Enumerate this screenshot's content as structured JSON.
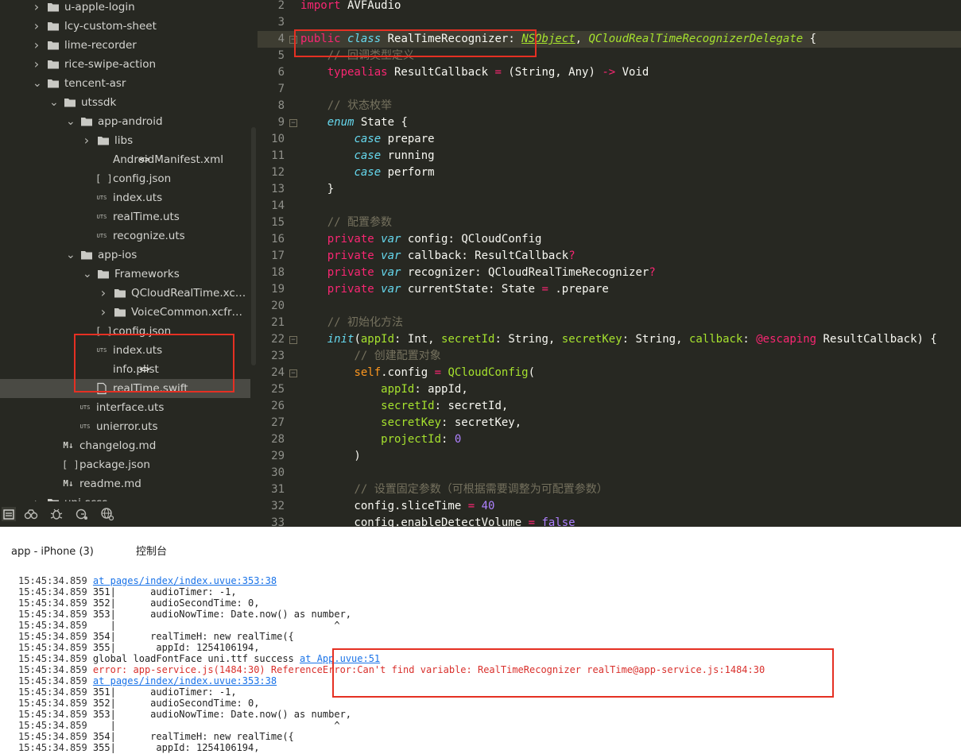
{
  "sidebar": {
    "items": [
      {
        "label": "u-apple-login",
        "depth": 2,
        "icon": "folder",
        "chevron": "right",
        "selected": false
      },
      {
        "label": "lcy-custom-sheet",
        "depth": 2,
        "icon": "folder",
        "chevron": "right",
        "selected": false
      },
      {
        "label": "lime-recorder",
        "depth": 2,
        "icon": "folder",
        "chevron": "right",
        "selected": false
      },
      {
        "label": "rice-swipe-action",
        "depth": 2,
        "icon": "folder",
        "chevron": "right",
        "selected": false
      },
      {
        "label": "tencent-asr",
        "depth": 2,
        "icon": "folder",
        "chevron": "down",
        "selected": false
      },
      {
        "label": "utssdk",
        "depth": 3,
        "icon": "folder",
        "chevron": "down",
        "selected": false
      },
      {
        "label": "app-android",
        "depth": 4,
        "icon": "folder",
        "chevron": "down",
        "selected": false
      },
      {
        "label": "libs",
        "depth": 5,
        "icon": "folder",
        "chevron": "right",
        "selected": false
      },
      {
        "label": "AndroidManifest.xml",
        "depth": 5,
        "icon": "code",
        "chevron": "",
        "selected": false
      },
      {
        "label": "config.json",
        "depth": 5,
        "icon": "brackets",
        "chevron": "",
        "selected": false
      },
      {
        "label": "index.uts",
        "depth": 5,
        "icon": "uts",
        "chevron": "",
        "selected": false
      },
      {
        "label": "realTime.uts",
        "depth": 5,
        "icon": "uts",
        "chevron": "",
        "selected": false
      },
      {
        "label": "recognize.uts",
        "depth": 5,
        "icon": "uts",
        "chevron": "",
        "selected": false
      },
      {
        "label": "app-ios",
        "depth": 4,
        "icon": "folder",
        "chevron": "down",
        "selected": false
      },
      {
        "label": "Frameworks",
        "depth": 5,
        "icon": "folder",
        "chevron": "down",
        "selected": false
      },
      {
        "label": "QCloudRealTime.xcf...",
        "depth": 6,
        "icon": "folder",
        "chevron": "right",
        "selected": false
      },
      {
        "label": "VoiceCommon.xcfra...",
        "depth": 6,
        "icon": "folder",
        "chevron": "right",
        "selected": false
      },
      {
        "label": "config.json",
        "depth": 5,
        "icon": "brackets",
        "chevron": "",
        "selected": false
      },
      {
        "label": "index.uts",
        "depth": 5,
        "icon": "uts",
        "chevron": "",
        "selected": false
      },
      {
        "label": "info.plist",
        "depth": 5,
        "icon": "code",
        "chevron": "",
        "selected": false
      },
      {
        "label": "realTime.swift",
        "depth": 5,
        "icon": "file",
        "chevron": "",
        "selected": true
      },
      {
        "label": "interface.uts",
        "depth": 4,
        "icon": "uts",
        "chevron": "",
        "selected": false
      },
      {
        "label": "unierror.uts",
        "depth": 4,
        "icon": "uts",
        "chevron": "",
        "selected": false
      },
      {
        "label": "changelog.md",
        "depth": 3,
        "icon": "markdown",
        "chevron": "",
        "selected": false
      },
      {
        "label": "package.json",
        "depth": 3,
        "icon": "brackets",
        "chevron": "",
        "selected": false
      },
      {
        "label": "readme.md",
        "depth": 3,
        "icon": "markdown",
        "chevron": "",
        "selected": false
      },
      {
        "label": "uni-scss",
        "depth": 2,
        "icon": "folder",
        "chevron": "right",
        "selected": false
      }
    ],
    "toolbar_icons": [
      "explorer-icon",
      "binoculars-icon",
      "debug-bug-icon",
      "git-icon",
      "globe-icon"
    ]
  },
  "editor": {
    "current_line": 4,
    "lines": [
      {
        "n": "2",
        "fold": false,
        "tokens": [
          [
            "kw",
            "import"
          ],
          [
            "pl",
            " AVFAudio"
          ]
        ]
      },
      {
        "n": "3",
        "fold": false,
        "tokens": []
      },
      {
        "n": "4",
        "fold": true,
        "tokens": [
          [
            "kw",
            "public"
          ],
          [
            "pl",
            " "
          ],
          [
            "kwi",
            "class"
          ],
          [
            "pl",
            " RealTimeRecognizer: "
          ],
          [
            "typeu",
            "NSObject"
          ],
          [
            "pl",
            ", "
          ],
          [
            "type",
            "QCloudRealTimeRecognizerDelegate"
          ],
          [
            "pl",
            " {"
          ]
        ]
      },
      {
        "n": "5",
        "fold": false,
        "tokens": [
          [
            "pl",
            "    "
          ],
          [
            "cm",
            "// 回调类型定义"
          ]
        ]
      },
      {
        "n": "6",
        "fold": false,
        "tokens": [
          [
            "pl",
            "    "
          ],
          [
            "kw",
            "typealias"
          ],
          [
            "pl",
            " ResultCallback "
          ],
          [
            "kw",
            "="
          ],
          [
            "pl",
            " (String, Any) "
          ],
          [
            "kw",
            "->"
          ],
          [
            "pl",
            " Void"
          ]
        ]
      },
      {
        "n": "7",
        "fold": false,
        "tokens": []
      },
      {
        "n": "8",
        "fold": false,
        "tokens": [
          [
            "pl",
            "    "
          ],
          [
            "cm",
            "// 状态枚举"
          ]
        ]
      },
      {
        "n": "9",
        "fold": true,
        "tokens": [
          [
            "pl",
            "    "
          ],
          [
            "kwi",
            "enum"
          ],
          [
            "pl",
            " State {"
          ]
        ]
      },
      {
        "n": "10",
        "fold": false,
        "tokens": [
          [
            "pl",
            "        "
          ],
          [
            "kwi",
            "case"
          ],
          [
            "pl",
            " prepare"
          ]
        ]
      },
      {
        "n": "11",
        "fold": false,
        "tokens": [
          [
            "pl",
            "        "
          ],
          [
            "kwi",
            "case"
          ],
          [
            "pl",
            " running"
          ]
        ]
      },
      {
        "n": "12",
        "fold": false,
        "tokens": [
          [
            "pl",
            "        "
          ],
          [
            "kwi",
            "case"
          ],
          [
            "pl",
            " perform"
          ]
        ]
      },
      {
        "n": "13",
        "fold": false,
        "tokens": [
          [
            "pl",
            "    }"
          ]
        ]
      },
      {
        "n": "14",
        "fold": false,
        "tokens": []
      },
      {
        "n": "15",
        "fold": false,
        "tokens": [
          [
            "pl",
            "    "
          ],
          [
            "cm",
            "// 配置参数"
          ]
        ]
      },
      {
        "n": "16",
        "fold": false,
        "tokens": [
          [
            "pl",
            "    "
          ],
          [
            "kw",
            "private"
          ],
          [
            "pl",
            " "
          ],
          [
            "kwi",
            "var"
          ],
          [
            "pl",
            " config: QCloudConfig"
          ]
        ]
      },
      {
        "n": "17",
        "fold": false,
        "tokens": [
          [
            "pl",
            "    "
          ],
          [
            "kw",
            "private"
          ],
          [
            "pl",
            " "
          ],
          [
            "kwi",
            "var"
          ],
          [
            "pl",
            " callback: ResultCallback"
          ],
          [
            "kw",
            "?"
          ]
        ]
      },
      {
        "n": "18",
        "fold": false,
        "tokens": [
          [
            "pl",
            "    "
          ],
          [
            "kw",
            "private"
          ],
          [
            "pl",
            " "
          ],
          [
            "kwi",
            "var"
          ],
          [
            "pl",
            " recognizer: QCloudRealTimeRecognizer"
          ],
          [
            "kw",
            "?"
          ]
        ]
      },
      {
        "n": "19",
        "fold": false,
        "tokens": [
          [
            "pl",
            "    "
          ],
          [
            "kw",
            "private"
          ],
          [
            "pl",
            " "
          ],
          [
            "kwi",
            "var"
          ],
          [
            "pl",
            " currentState: State "
          ],
          [
            "kw",
            "="
          ],
          [
            "pl",
            " .prepare"
          ]
        ]
      },
      {
        "n": "20",
        "fold": false,
        "tokens": []
      },
      {
        "n": "21",
        "fold": false,
        "tokens": [
          [
            "pl",
            "    "
          ],
          [
            "cm",
            "// 初始化方法"
          ]
        ]
      },
      {
        "n": "22",
        "fold": true,
        "tokens": [
          [
            "pl",
            "    "
          ],
          [
            "kwi",
            "init"
          ],
          [
            "pl",
            "("
          ],
          [
            "param",
            "appId"
          ],
          [
            "pl",
            ": Int, "
          ],
          [
            "param",
            "secretId"
          ],
          [
            "pl",
            ": String, "
          ],
          [
            "param",
            "secretKey"
          ],
          [
            "pl",
            ": String, "
          ],
          [
            "param",
            "callback"
          ],
          [
            "pl",
            ": "
          ],
          [
            "kw",
            "@escaping"
          ],
          [
            "pl",
            " ResultCallback) {"
          ]
        ]
      },
      {
        "n": "23",
        "fold": false,
        "tokens": [
          [
            "pl",
            "        "
          ],
          [
            "cm",
            "// 创建配置对象"
          ]
        ]
      },
      {
        "n": "24",
        "fold": true,
        "tokens": [
          [
            "pl",
            "        "
          ],
          [
            "self",
            "self"
          ],
          [
            "pl",
            ".config "
          ],
          [
            "kw",
            "="
          ],
          [
            "pl",
            " "
          ],
          [
            "fn",
            "QCloudConfig"
          ],
          [
            "pl",
            "("
          ]
        ]
      },
      {
        "n": "25",
        "fold": false,
        "tokens": [
          [
            "pl",
            "            "
          ],
          [
            "param",
            "appId"
          ],
          [
            "pl",
            ": appId,"
          ]
        ]
      },
      {
        "n": "26",
        "fold": false,
        "tokens": [
          [
            "pl",
            "            "
          ],
          [
            "param",
            "secretId"
          ],
          [
            "pl",
            ": secretId,"
          ]
        ]
      },
      {
        "n": "27",
        "fold": false,
        "tokens": [
          [
            "pl",
            "            "
          ],
          [
            "param",
            "secretKey"
          ],
          [
            "pl",
            ": secretKey,"
          ]
        ]
      },
      {
        "n": "28",
        "fold": false,
        "tokens": [
          [
            "pl",
            "            "
          ],
          [
            "param",
            "projectId"
          ],
          [
            "pl",
            ": "
          ],
          [
            "num",
            "0"
          ]
        ]
      },
      {
        "n": "29",
        "fold": false,
        "tokens": [
          [
            "pl",
            "        )"
          ]
        ]
      },
      {
        "n": "30",
        "fold": false,
        "tokens": []
      },
      {
        "n": "31",
        "fold": false,
        "tokens": [
          [
            "pl",
            "        "
          ],
          [
            "cm",
            "// 设置固定参数（可根据需要调整为可配置参数）"
          ]
        ]
      },
      {
        "n": "32",
        "fold": false,
        "tokens": [
          [
            "pl",
            "        config.sliceTime "
          ],
          [
            "kw",
            "="
          ],
          [
            "pl",
            " "
          ],
          [
            "num",
            "40"
          ]
        ]
      },
      {
        "n": "33",
        "fold": false,
        "tokens": [
          [
            "pl",
            "        config.enableDetectVolume "
          ],
          [
            "kw",
            "="
          ],
          [
            "pl",
            " "
          ],
          [
            "num",
            "false"
          ]
        ]
      }
    ]
  },
  "panel": {
    "tabs": [
      "app - iPhone (3)",
      "控制台"
    ]
  },
  "console": {
    "lines": [
      {
        "parts": [
          [
            "ts",
            "15:45:34.859 "
          ],
          [
            "lk",
            "at pages/index/index.uvue:353:38"
          ]
        ]
      },
      {
        "parts": [
          [
            "ts",
            "15:45:34.859 "
          ],
          [
            "tx",
            "351|      audioTimer: -1,"
          ]
        ]
      },
      {
        "parts": [
          [
            "ts",
            "15:45:34.859 "
          ],
          [
            "tx",
            "352|      audioSecondTime: 0,"
          ]
        ]
      },
      {
        "parts": [
          [
            "ts",
            "15:45:34.859 "
          ],
          [
            "tx",
            "353|      audioNowTime: Date.now() as number,"
          ]
        ]
      },
      {
        "parts": [
          [
            "ts",
            "15:45:34.859 "
          ],
          [
            "tx",
            "   |                                      ^"
          ]
        ]
      },
      {
        "parts": [
          [
            "ts",
            "15:45:34.859 "
          ],
          [
            "tx",
            "354|      realTimeH: new realTime({"
          ]
        ]
      },
      {
        "parts": [
          [
            "ts",
            "15:45:34.859 "
          ],
          [
            "tx",
            "355|       appId: 1254106194,"
          ]
        ]
      },
      {
        "parts": [
          [
            "ts",
            "15:45:34.859 "
          ],
          [
            "tx",
            "global loadFontFace uni.ttf success "
          ],
          [
            "lk",
            "at App.uvue:51"
          ]
        ]
      },
      {
        "parts": [
          [
            "ts",
            "15:45:34.859 "
          ],
          [
            "er",
            "error: app-service.js(1484:30) ReferenceError:Can't find variable: RealTimeRecognizer realTime@app-service.js:1484:30"
          ]
        ]
      },
      {
        "parts": [
          [
            "ts",
            "15:45:34.859 "
          ],
          [
            "lk",
            "at pages/index/index.uvue:353:38"
          ]
        ]
      },
      {
        "parts": [
          [
            "ts",
            "15:45:34.859 "
          ],
          [
            "tx",
            "351|      audioTimer: -1,"
          ]
        ]
      },
      {
        "parts": [
          [
            "ts",
            "15:45:34.859 "
          ],
          [
            "tx",
            "352|      audioSecondTime: 0,"
          ]
        ]
      },
      {
        "parts": [
          [
            "ts",
            "15:45:34.859 "
          ],
          [
            "tx",
            "353|      audioNowTime: Date.now() as number,"
          ]
        ]
      },
      {
        "parts": [
          [
            "ts",
            "15:45:34.859 "
          ],
          [
            "tx",
            "   |                                      ^"
          ]
        ]
      },
      {
        "parts": [
          [
            "ts",
            "15:45:34.859 "
          ],
          [
            "tx",
            "354|      realTimeH: new realTime({"
          ]
        ]
      },
      {
        "parts": [
          [
            "ts",
            "15:45:34.859 "
          ],
          [
            "tx",
            "355|       appId: 1254106194,"
          ]
        ]
      }
    ]
  },
  "colors": {
    "editor_bg": "#272822",
    "annotation_red": "#e53023",
    "link_blue": "#1a73e8",
    "error_red": "#d9302c"
  }
}
